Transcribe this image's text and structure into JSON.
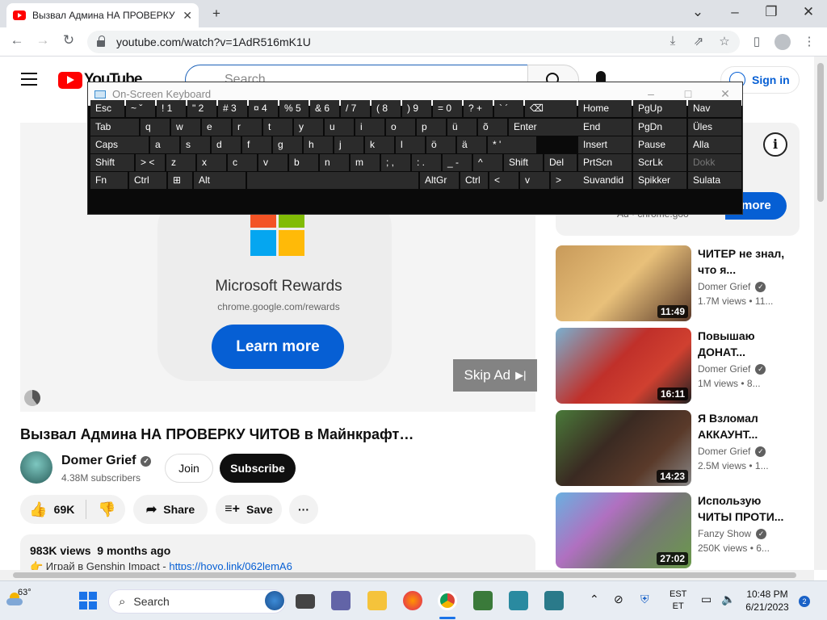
{
  "browser": {
    "tab_title": "Вызвал Админа НА ПРОВЕРКУ Ч",
    "tab_close": "✕",
    "new_tab": "+",
    "url": "youtube.com/watch?v=1AdR516mK1U",
    "window_controls": {
      "minimize": "–",
      "restore": "❐",
      "close": "✕",
      "tabs_menu": "⌄"
    }
  },
  "youtube": {
    "logo_text": "YouTube",
    "search_placeholder": "Search",
    "sign_in": "Sign in"
  },
  "ad": {
    "title": "Microsoft Rewards",
    "url": "chrome.google.com/rewards",
    "cta": "Learn more",
    "skip": "Skip Ad",
    "side_cta": "more",
    "side_line": "Ad · chrome.goo",
    "info": "i"
  },
  "video": {
    "title": "Вызвал Админа НА ПРОВЕРКУ ЧИТОВ в Майнкрафт…",
    "channel": "Domer Grief",
    "subscribers": "4.38M subscribers",
    "join": "Join",
    "subscribe": "Subscribe",
    "likes": "69K",
    "share": "Share",
    "save": "Save",
    "more": "···",
    "views": "983K views",
    "age": "9 months ago",
    "desc_prefix": "👉 Играй в Genshin Impact - ",
    "desc_link": "https://hoyo.link/062lemA6"
  },
  "related": [
    {
      "title": "ЧИТЕР не знал, что я...",
      "channel": "Domer Grief",
      "views": "1.7M views",
      "age": "• 11...",
      "duration": "11:49"
    },
    {
      "title": "Повышаю ДОНАТ...",
      "channel": "Domer Grief",
      "views": "1M views",
      "age": "• 8...",
      "duration": "16:11"
    },
    {
      "title": "Я Взломал АККАУНТ...",
      "channel": "Domer Grief",
      "views": "2.5M views",
      "age": "• 1...",
      "duration": "14:23"
    },
    {
      "title": "Использую ЧИТЫ ПРОТИ...",
      "channel": "Fanzy Show",
      "views": "250K views",
      "age": "• 6...",
      "duration": "27:02"
    }
  ],
  "osk": {
    "title": "On-Screen Keyboard",
    "rows": [
      [
        "Esc",
        "~ ˇ",
        "! 1",
        "\" 2",
        "# 3",
        "¤ 4",
        "% 5",
        "& 6",
        "/ 7",
        "( 8",
        ") 9",
        "= 0",
        "? +",
        "` ´",
        "⌫",
        "Home",
        "PgUp",
        "Nav"
      ],
      [
        "Tab",
        "q",
        "w",
        "e",
        "r",
        "t",
        "y",
        "u",
        "i",
        "o",
        "p",
        "ü",
        "õ",
        "Enter",
        "End",
        "PgDn",
        "Üles"
      ],
      [
        "Caps",
        "a",
        "s",
        "d",
        "f",
        "g",
        "h",
        "j",
        "k",
        "l",
        "ö",
        "ä",
        "* '",
        "Insert",
        "Pause",
        "Alla"
      ],
      [
        "Shift",
        "> <",
        "z",
        "x",
        "c",
        "v",
        "b",
        "n",
        "m",
        "; ,",
        ": .",
        "_ -",
        "^",
        "Shift",
        "Del",
        "PrtScn",
        "ScrLk",
        "Dokk"
      ],
      [
        "Fn",
        "Ctrl",
        "⊞",
        "Alt",
        "",
        "AltGr",
        "Ctrl",
        "<",
        "v",
        ">",
        "☰",
        "Suvandid",
        "Spikker",
        "Sulata"
      ]
    ]
  },
  "taskbar": {
    "weather": "63°",
    "search": "Search",
    "lang1": "EST",
    "lang2": "ET",
    "time": "10:48 PM",
    "date": "6/21/2023",
    "notifications": "2"
  }
}
